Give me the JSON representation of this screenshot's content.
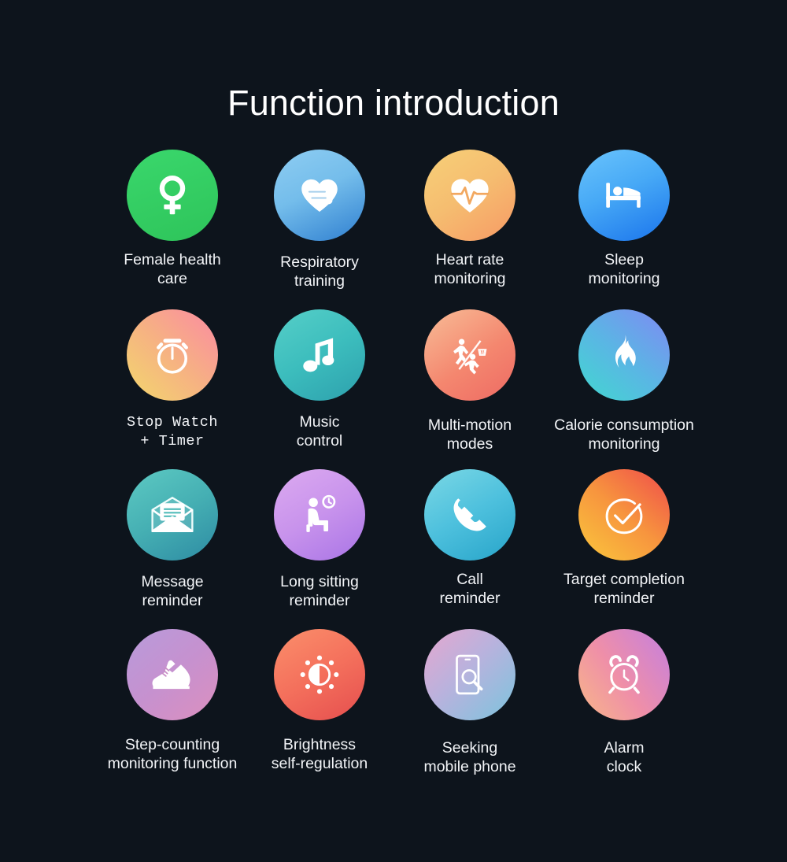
{
  "page": {
    "title": "Function introduction",
    "background_color": "#0d141c",
    "text_color": "#f2f4f7"
  },
  "grid": {
    "columns": 4,
    "rows": 4,
    "items": [
      {
        "label": "Female health\ncare",
        "icon": "female-symbol-icon",
        "gradient_from": "#2ec85c",
        "gradient_to": "#4ade7c"
      },
      {
        "label": "Respiratory\ntraining",
        "icon": "heart-wind-icon",
        "gradient_from": "#8ecdf2",
        "gradient_to": "#2f7fd0"
      },
      {
        "label": "Heart rate\nmonitoring",
        "icon": "heart-pulse-icon",
        "gradient_from": "#f6cf76",
        "gradient_to": "#f79d68"
      },
      {
        "label": "Sleep\nmonitoring",
        "icon": "bed-icon",
        "gradient_from": "#62c0fb",
        "gradient_to": "#1a76ec"
      },
      {
        "label": "Stop Watch\n+ Timer",
        "icon": "stopwatch-icon",
        "gradient_from": "#f3d86c",
        "gradient_to": "#fb8aa3"
      },
      {
        "label": "Music\ncontrol",
        "icon": "music-note-icon",
        "gradient_from": "#4fc9c4",
        "gradient_to": "#2ea7ad"
      },
      {
        "label": "Multi-motion\nmodes",
        "icon": "multi-sport-icon",
        "gradient_from": "#f7b894",
        "gradient_to": "#ef6b63"
      },
      {
        "label": "Calorie consumption\nmonitoring",
        "icon": "flame-icon",
        "gradient_from": "#41d8cf",
        "gradient_to": "#7f8ef2"
      },
      {
        "label": "Message\nreminder",
        "icon": "envelope-message-icon",
        "gradient_from": "#59c6c0",
        "gradient_to": "#2f8fa2"
      },
      {
        "label": "Long sitting\nreminder",
        "icon": "sitting-person-clock-icon",
        "gradient_from": "#d9a8ef",
        "gradient_to": "#a濃"
      },
      {
        "label": "Call\nreminder",
        "icon": "phone-handset-icon",
        "gradient_from": "#72d3e2",
        "gradient_to": "#2aa6c8"
      },
      {
        "label": "Target completion\nreminder",
        "icon": "check-circle-icon",
        "gradient_from": "#f9c23c",
        "gradient_to": "#ef4b4b"
      },
      {
        "label": "Step-counting\nmonitoring function",
        "icon": "sneaker-icon",
        "gradient_from": "#b69ad9",
        "gradient_to": "#d98fc0"
      },
      {
        "label": "Brightness\nself-regulation",
        "icon": "brightness-icon",
        "gradient_from": "#fa8a68",
        "gradient_to": "#e64e4e"
      },
      {
        "label": "Seeking\nmobile phone",
        "icon": "phone-search-icon",
        "gradient_from": "#e3a6cd",
        "gradient_to": "#7fc3dc"
      },
      {
        "label": "Alarm\nclock",
        "icon": "alarm-clock-icon",
        "gradient_from": "#f7b487",
        "gradient_to": "#c47fe0"
      }
    ]
  }
}
